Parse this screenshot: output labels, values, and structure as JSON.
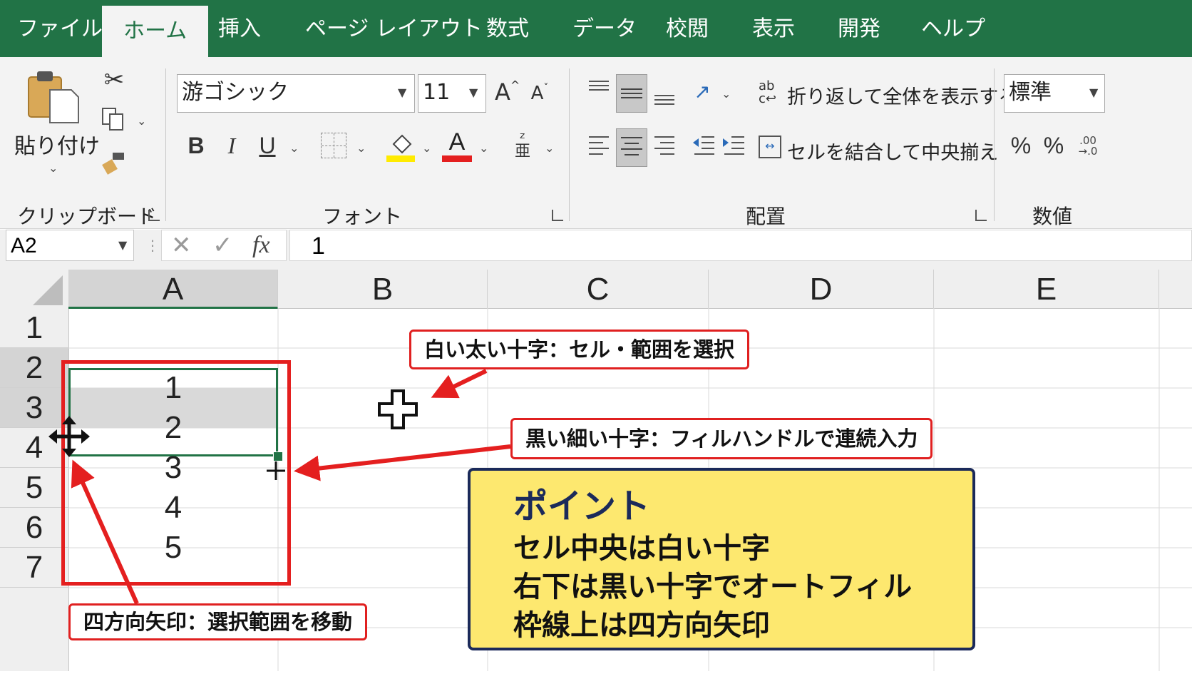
{
  "tabs": [
    "ファイル",
    "ホーム",
    "挿入",
    "ページ レイアウト",
    "数式",
    "データ",
    "校閲",
    "表示",
    "開発",
    "ヘルプ"
  ],
  "ribbon": {
    "clipboard": {
      "paste_label": "貼り付け",
      "group_label": "クリップボード"
    },
    "font": {
      "font_name": "游ゴシック",
      "font_size": "11",
      "group_label": "フォント",
      "bold": "B",
      "italic": "I",
      "underline": "U",
      "grow": "A",
      "shrink": "A",
      "font_color_glyph": "A"
    },
    "alignment": {
      "wrap_text": "折り返して全体を表示する",
      "merge_center": "セルを結合して中央揃え",
      "group_label": "配置"
    },
    "number": {
      "format": "標準",
      "group_label": "数値",
      "percent": "%",
      "comma": "%"
    }
  },
  "formula_bar": {
    "name_box": "A2",
    "cancel": "✕",
    "enter": "✓",
    "fx": "fx",
    "value": "1"
  },
  "sheet": {
    "columns": [
      "A",
      "B",
      "C",
      "D",
      "E"
    ],
    "rows": [
      "1",
      "2",
      "3",
      "4",
      "5",
      "6",
      "7"
    ],
    "a_values": [
      "1",
      "2",
      "3",
      "4",
      "5"
    ]
  },
  "callouts": {
    "white_cross": "白い太い十字：セル・範囲を選択",
    "black_cross": "黒い細い十字：フィルハンドルで連続入力",
    "four_arrow": "四方向矢印：選択範囲を移動"
  },
  "point_box": {
    "title": "ポイント",
    "lines": [
      "セル中央は白い十字",
      "右下は黒い十字でオートフィル",
      "枠線上は四方向矢印"
    ]
  },
  "colors": {
    "excel_green": "#217346",
    "callout_red": "#e02020",
    "point_bg": "#fde86f",
    "point_border": "#1b2a5a"
  }
}
